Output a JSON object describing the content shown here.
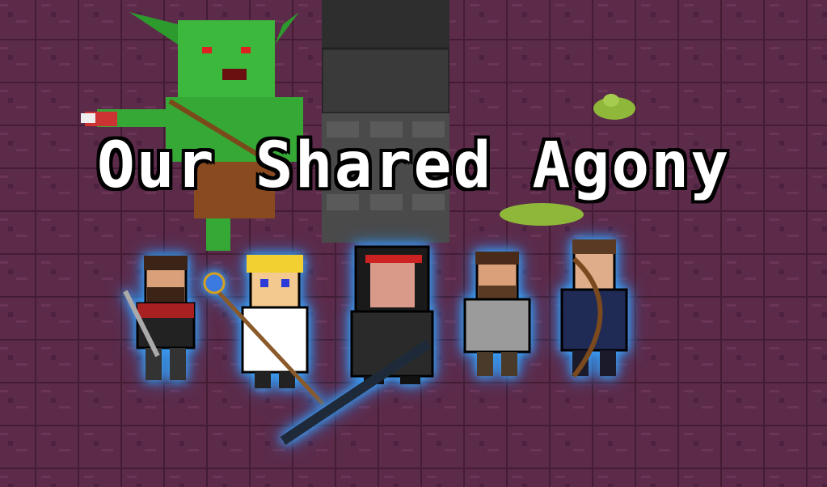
{
  "title": "Our Shared Agony",
  "scene": {
    "floor_color": "#5c2b4a",
    "floor_line_color": "#4a2038",
    "corridor_color": "#3a3a3a",
    "glow_color": "#3fa9ff"
  },
  "characters": [
    {
      "name": "swordsman",
      "icon": "swordsman-icon"
    },
    {
      "name": "cleric",
      "icon": "cleric-icon"
    },
    {
      "name": "rogue",
      "icon": "rogue-icon"
    },
    {
      "name": "brawler",
      "icon": "brawler-icon"
    },
    {
      "name": "archer",
      "icon": "archer-icon"
    }
  ],
  "enemies": [
    {
      "name": "goblin",
      "icon": "goblin-icon"
    },
    {
      "name": "slime",
      "icon": "slime-icon"
    }
  ]
}
